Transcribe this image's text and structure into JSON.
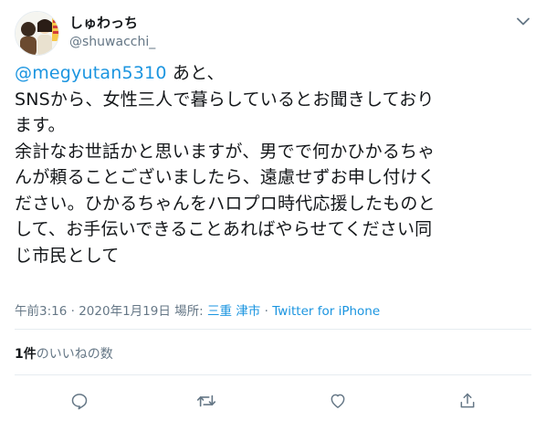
{
  "user": {
    "display_name": "しゅわっち",
    "handle": "@shuwacchi_",
    "avatar_icon": "user-avatar-icon"
  },
  "tweet": {
    "mention": "@megyutan5310",
    "lines": [
      " あと、",
      "SNSから、女性三人で暮らしているとお聞きしており",
      "ます。",
      "余計なお世話かと思いますが、男でで何かひかるちゃ",
      "んが頼ることございましたら、遠慮せずお申し付けく",
      "ださい。ひかるちゃんをハロプロ時代応援したものと",
      "して、お手伝いできることあればやらせてください同",
      "じ市民として"
    ]
  },
  "meta": {
    "time": "午前3:16",
    "separator": "·",
    "date": "2020年1月19日",
    "place_label": "場所:",
    "place": "三重 津市",
    "source": "Twitter for iPhone"
  },
  "likes": {
    "count": "1件",
    "label": "のいいねの数"
  },
  "colors": {
    "link": "#1b95e0",
    "text": "#14171a",
    "muted": "#657786",
    "divider": "#e6ecf0"
  },
  "icons": [
    "chevron-down-icon",
    "reply-icon",
    "retweet-icon",
    "like-icon",
    "share-icon"
  ]
}
